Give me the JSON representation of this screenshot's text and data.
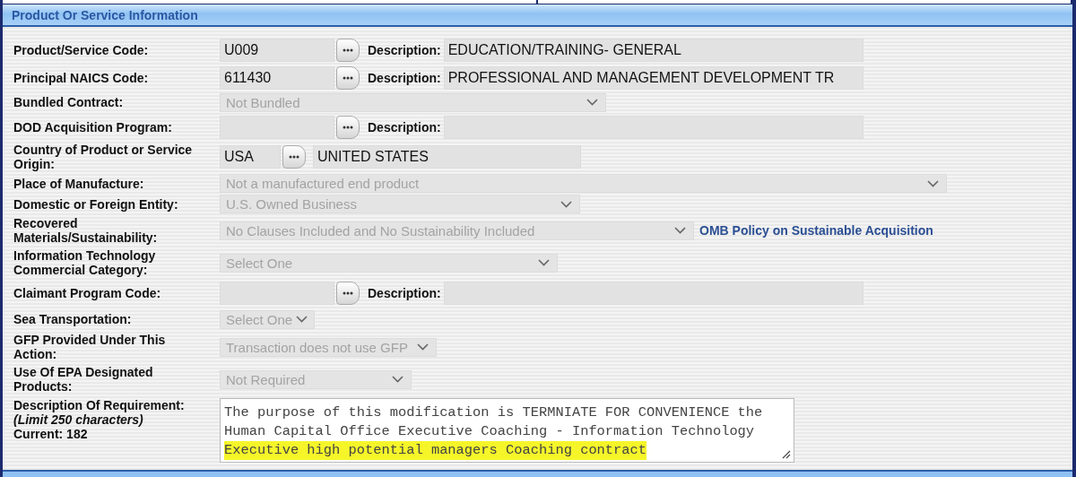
{
  "section": {
    "title": "Product Or Service Information"
  },
  "rows": [
    {
      "kind": "lookup",
      "label": "Product/Service Code:",
      "code": "U009",
      "description_label": "Description:",
      "description": "EDUCATION/TRAINING- GENERAL"
    },
    {
      "kind": "lookup",
      "label": "Principal NAICS Code:",
      "code": "611430",
      "description_label": "Description:",
      "description": "PROFESSIONAL AND MANAGEMENT DEVELOPMENT TR"
    },
    {
      "kind": "select",
      "label": "Bundled Contract:",
      "value": "Not Bundled",
      "disabled": true
    },
    {
      "kind": "lookup",
      "label": "DOD Acquisition Program:",
      "code": "",
      "description_label": "Description:",
      "description": ""
    },
    {
      "kind": "country",
      "label": "Country of Product or Service Origin:",
      "code": "USA",
      "name": "UNITED STATES"
    },
    {
      "kind": "select",
      "label": "Place of Manufacture:",
      "value": "Not a manufactured end product",
      "disabled": true
    },
    {
      "kind": "select",
      "label": "Domestic or Foreign Entity:",
      "value": "U.S. Owned Business",
      "disabled": true
    },
    {
      "kind": "select",
      "label": "Recovered Materials/Sustainability:",
      "value": "No Clauses Included and No Sustainability Included",
      "disabled": true,
      "link": "OMB Policy on Sustainable Acquisition"
    },
    {
      "kind": "select",
      "label": "Information Technology Commercial Category:",
      "value": "Select One",
      "disabled": true
    },
    {
      "kind": "lookup",
      "label": "Claimant Program Code:",
      "code": "",
      "description_label": "Description:",
      "description": ""
    },
    {
      "kind": "select",
      "label": "Sea Transportation:",
      "value": "Select One",
      "disabled": true
    },
    {
      "kind": "select",
      "label": "GFP Provided Under This Action:",
      "value": "Transaction does not use GFP",
      "disabled": true
    },
    {
      "kind": "select",
      "label": "Use Of EPA Designated Products:",
      "value": "Not Required",
      "disabled": true
    },
    {
      "kind": "textarea",
      "label": "Description Of Requirement:",
      "note": "(Limit 250 characters)",
      "counter": "Current: 182",
      "lines": [
        {
          "text": "The purpose of this modification is TERMNIATE FOR CONVENIENCE the",
          "highlighted": false
        },
        {
          "text": "Human Capital Office Executive Coaching - Information Technology",
          "highlighted": false
        },
        {
          "text": "Executive high potential managers Coaching contract",
          "highlighted": true
        }
      ]
    }
  ]
}
